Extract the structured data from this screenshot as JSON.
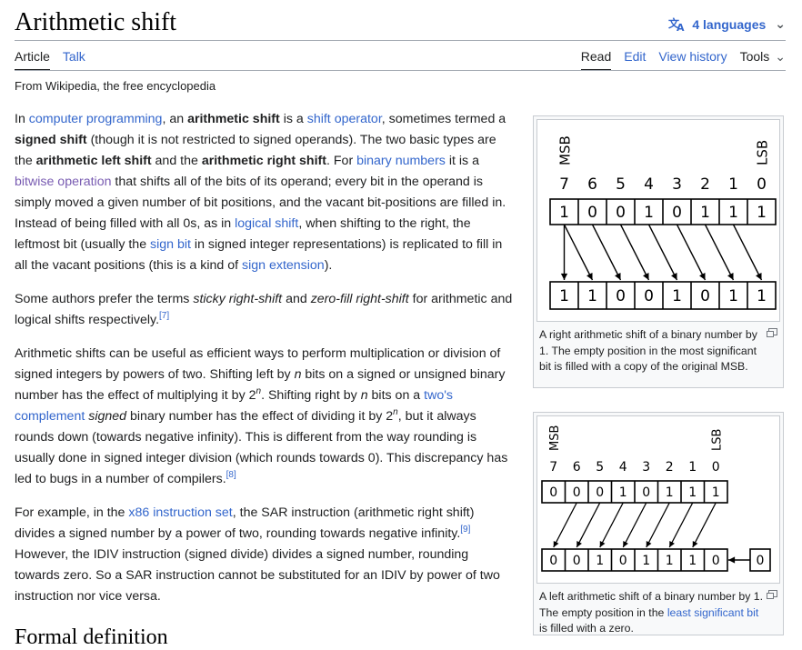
{
  "title": "Arithmetic shift",
  "languages": "4 languages",
  "tabs_left": [
    "Article",
    "Talk"
  ],
  "tabs_right": [
    "Read",
    "Edit",
    "View history",
    "Tools"
  ],
  "tagline": "From Wikipedia, the free encyclopedia",
  "p1": {
    "t1": "In ",
    "l1": "computer programming",
    "t2": ", an ",
    "b1": "arithmetic shift",
    "t3": " is a ",
    "l2": "shift operator",
    "t4": ", sometimes termed a ",
    "b2": "signed shift",
    "t5": " (though it is not restricted to signed operands). The two basic types are the ",
    "b3": "arithmetic left shift",
    "t6": " and the ",
    "b4": "arithmetic right shift",
    "t7": ". For ",
    "l3": "binary numbers",
    "t8": " it is a ",
    "l4": "bitwise operation",
    "t9": " that shifts all of the bits of its operand; every bit in the operand is simply moved a given number of bit positions, and the vacant bit-positions are filled in. Instead of being filled with all 0s, as in ",
    "l5": "logical shift",
    "t10": ", when shifting to the right, the leftmost bit (usually the ",
    "l6": "sign bit",
    "t11": " in signed integer representations) is replicated to fill in all the vacant positions (this is a kind of ",
    "l7": "sign extension",
    "t12": ")."
  },
  "p2": {
    "t1": "Some authors prefer the terms ",
    "i1": "sticky right-shift",
    "t2": " and ",
    "i2": "zero-fill right-shift",
    "t3": " for arithmetic and logical shifts respectively.",
    "ref": "[7]"
  },
  "p3": {
    "t1": "Arithmetic shifts can be useful as efficient ways to perform multiplication or division of signed integers by powers of two. Shifting left by ",
    "n1": "n",
    "t2": " bits on a signed or unsigned binary number has the effect of multiplying it by 2",
    "e1": "n",
    "t3": ". Shifting right by ",
    "n2": "n",
    "t4": " bits on a ",
    "l1": "two's complement",
    "t5": " ",
    "i1": "signed",
    "t6": " binary number has the effect of dividing it by 2",
    "e2": "n",
    "t7": ", but it always rounds down (towards negative infinity). This is different from the way rounding is usually done in signed integer division (which rounds towards 0). This discrepancy has led to bugs in a number of compilers.",
    "ref": "[8]"
  },
  "p4": {
    "t1": "For example, in the ",
    "l1": "x86 instruction set",
    "t2": ", the SAR instruction (arithmetic right shift) divides a signed number by a power of two, rounding towards negative infinity.",
    "ref": "[9]",
    "t3": " However, the IDIV instruction (signed divide) divides a signed number, rounding towards zero. So a SAR instruction cannot be substituted for an IDIV by power of two instruction nor vice versa."
  },
  "figure1": {
    "msb": "MSB",
    "lsb": "LSB",
    "indices": [
      "7",
      "6",
      "5",
      "4",
      "3",
      "2",
      "1",
      "0"
    ],
    "input_bits": [
      "1",
      "0",
      "0",
      "1",
      "0",
      "1",
      "1",
      "1"
    ],
    "output_bits": [
      "1",
      "1",
      "0",
      "0",
      "1",
      "0",
      "1",
      "1"
    ],
    "caption": "A right arithmetic shift of a binary number by 1. The empty position in the most significant bit is filled with a copy of the original MSB."
  },
  "figure2": {
    "msb": "MSB",
    "lsb": "LSB",
    "indices": [
      "7",
      "6",
      "5",
      "4",
      "3",
      "2",
      "1",
      "0"
    ],
    "input_bits": [
      "0",
      "0",
      "0",
      "1",
      "0",
      "1",
      "1",
      "1"
    ],
    "output_bits": [
      "0",
      "0",
      "1",
      "0",
      "1",
      "1",
      "1",
      "0"
    ],
    "fill_bit": "0",
    "caption_t1": "A left arithmetic shift of a binary number by 1. The empty position in the ",
    "caption_link": "least significant bit",
    "caption_t2": " is filled with a zero."
  },
  "next_heading": "Formal definition"
}
